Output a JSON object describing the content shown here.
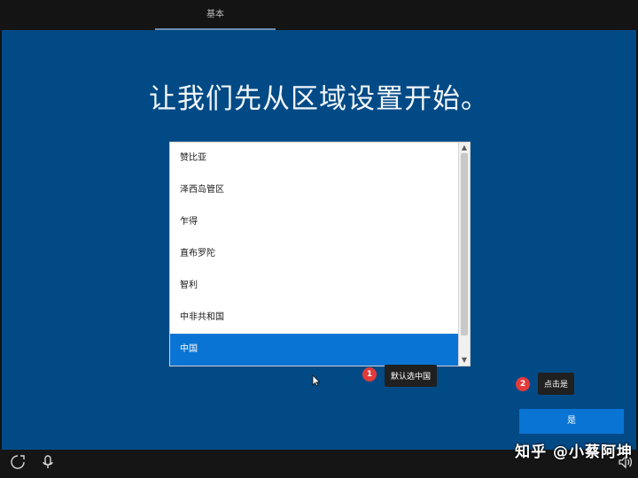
{
  "topbar": {
    "tab_label": "基本"
  },
  "page": {
    "title": "让我们先从区域设置开始。"
  },
  "region_list": {
    "items": [
      {
        "label": "赞比亚",
        "selected": false
      },
      {
        "label": "泽西岛管区",
        "selected": false
      },
      {
        "label": "乍得",
        "selected": false
      },
      {
        "label": "直布罗陀",
        "selected": false
      },
      {
        "label": "智利",
        "selected": false
      },
      {
        "label": "中非共和国",
        "selected": false
      },
      {
        "label": "中国",
        "selected": true
      }
    ]
  },
  "annotations": {
    "step1_number": "1",
    "step1_text": "默认选中国",
    "step2_number": "2",
    "step2_text": "点击是"
  },
  "actions": {
    "yes_label": "是"
  },
  "bottombar": {
    "left_icons": [
      "accessibility-icon",
      "microphone-icon"
    ],
    "right_icon": "speaker-icon"
  },
  "watermark": {
    "text": "知乎 @小蔡阿坤"
  },
  "colors": {
    "background_blue": "#024a85",
    "selected_blue": "#0a74d4",
    "badge_red": "#e43a3a"
  }
}
